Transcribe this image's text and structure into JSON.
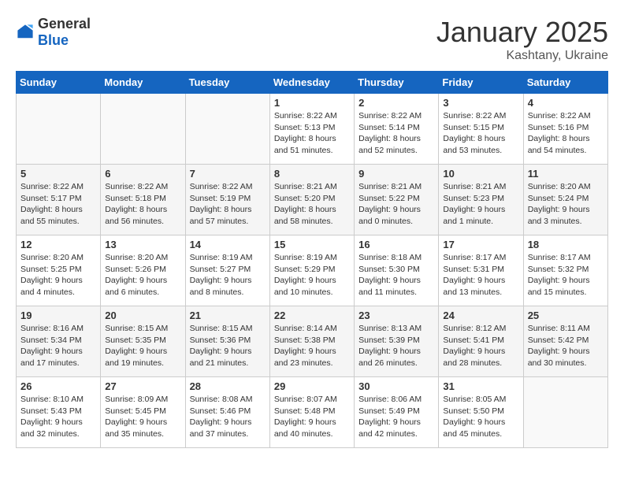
{
  "header": {
    "logo_general": "General",
    "logo_blue": "Blue",
    "month": "January 2025",
    "location": "Kashtany, Ukraine"
  },
  "days_of_week": [
    "Sunday",
    "Monday",
    "Tuesday",
    "Wednesday",
    "Thursday",
    "Friday",
    "Saturday"
  ],
  "weeks": [
    {
      "days": [
        {
          "number": "",
          "info": ""
        },
        {
          "number": "",
          "info": ""
        },
        {
          "number": "",
          "info": ""
        },
        {
          "number": "1",
          "info": "Sunrise: 8:22 AM\nSunset: 5:13 PM\nDaylight: 8 hours\nand 51 minutes."
        },
        {
          "number": "2",
          "info": "Sunrise: 8:22 AM\nSunset: 5:14 PM\nDaylight: 8 hours\nand 52 minutes."
        },
        {
          "number": "3",
          "info": "Sunrise: 8:22 AM\nSunset: 5:15 PM\nDaylight: 8 hours\nand 53 minutes."
        },
        {
          "number": "4",
          "info": "Sunrise: 8:22 AM\nSunset: 5:16 PM\nDaylight: 8 hours\nand 54 minutes."
        }
      ]
    },
    {
      "days": [
        {
          "number": "5",
          "info": "Sunrise: 8:22 AM\nSunset: 5:17 PM\nDaylight: 8 hours\nand 55 minutes."
        },
        {
          "number": "6",
          "info": "Sunrise: 8:22 AM\nSunset: 5:18 PM\nDaylight: 8 hours\nand 56 minutes."
        },
        {
          "number": "7",
          "info": "Sunrise: 8:22 AM\nSunset: 5:19 PM\nDaylight: 8 hours\nand 57 minutes."
        },
        {
          "number": "8",
          "info": "Sunrise: 8:21 AM\nSunset: 5:20 PM\nDaylight: 8 hours\nand 58 minutes."
        },
        {
          "number": "9",
          "info": "Sunrise: 8:21 AM\nSunset: 5:22 PM\nDaylight: 9 hours\nand 0 minutes."
        },
        {
          "number": "10",
          "info": "Sunrise: 8:21 AM\nSunset: 5:23 PM\nDaylight: 9 hours\nand 1 minute."
        },
        {
          "number": "11",
          "info": "Sunrise: 8:20 AM\nSunset: 5:24 PM\nDaylight: 9 hours\nand 3 minutes."
        }
      ]
    },
    {
      "days": [
        {
          "number": "12",
          "info": "Sunrise: 8:20 AM\nSunset: 5:25 PM\nDaylight: 9 hours\nand 4 minutes."
        },
        {
          "number": "13",
          "info": "Sunrise: 8:20 AM\nSunset: 5:26 PM\nDaylight: 9 hours\nand 6 minutes."
        },
        {
          "number": "14",
          "info": "Sunrise: 8:19 AM\nSunset: 5:27 PM\nDaylight: 9 hours\nand 8 minutes."
        },
        {
          "number": "15",
          "info": "Sunrise: 8:19 AM\nSunset: 5:29 PM\nDaylight: 9 hours\nand 10 minutes."
        },
        {
          "number": "16",
          "info": "Sunrise: 8:18 AM\nSunset: 5:30 PM\nDaylight: 9 hours\nand 11 minutes."
        },
        {
          "number": "17",
          "info": "Sunrise: 8:17 AM\nSunset: 5:31 PM\nDaylight: 9 hours\nand 13 minutes."
        },
        {
          "number": "18",
          "info": "Sunrise: 8:17 AM\nSunset: 5:32 PM\nDaylight: 9 hours\nand 15 minutes."
        }
      ]
    },
    {
      "days": [
        {
          "number": "19",
          "info": "Sunrise: 8:16 AM\nSunset: 5:34 PM\nDaylight: 9 hours\nand 17 minutes."
        },
        {
          "number": "20",
          "info": "Sunrise: 8:15 AM\nSunset: 5:35 PM\nDaylight: 9 hours\nand 19 minutes."
        },
        {
          "number": "21",
          "info": "Sunrise: 8:15 AM\nSunset: 5:36 PM\nDaylight: 9 hours\nand 21 minutes."
        },
        {
          "number": "22",
          "info": "Sunrise: 8:14 AM\nSunset: 5:38 PM\nDaylight: 9 hours\nand 23 minutes."
        },
        {
          "number": "23",
          "info": "Sunrise: 8:13 AM\nSunset: 5:39 PM\nDaylight: 9 hours\nand 26 minutes."
        },
        {
          "number": "24",
          "info": "Sunrise: 8:12 AM\nSunset: 5:41 PM\nDaylight: 9 hours\nand 28 minutes."
        },
        {
          "number": "25",
          "info": "Sunrise: 8:11 AM\nSunset: 5:42 PM\nDaylight: 9 hours\nand 30 minutes."
        }
      ]
    },
    {
      "days": [
        {
          "number": "26",
          "info": "Sunrise: 8:10 AM\nSunset: 5:43 PM\nDaylight: 9 hours\nand 32 minutes."
        },
        {
          "number": "27",
          "info": "Sunrise: 8:09 AM\nSunset: 5:45 PM\nDaylight: 9 hours\nand 35 minutes."
        },
        {
          "number": "28",
          "info": "Sunrise: 8:08 AM\nSunset: 5:46 PM\nDaylight: 9 hours\nand 37 minutes."
        },
        {
          "number": "29",
          "info": "Sunrise: 8:07 AM\nSunset: 5:48 PM\nDaylight: 9 hours\nand 40 minutes."
        },
        {
          "number": "30",
          "info": "Sunrise: 8:06 AM\nSunset: 5:49 PM\nDaylight: 9 hours\nand 42 minutes."
        },
        {
          "number": "31",
          "info": "Sunrise: 8:05 AM\nSunset: 5:50 PM\nDaylight: 9 hours\nand 45 minutes."
        },
        {
          "number": "",
          "info": ""
        }
      ]
    }
  ]
}
